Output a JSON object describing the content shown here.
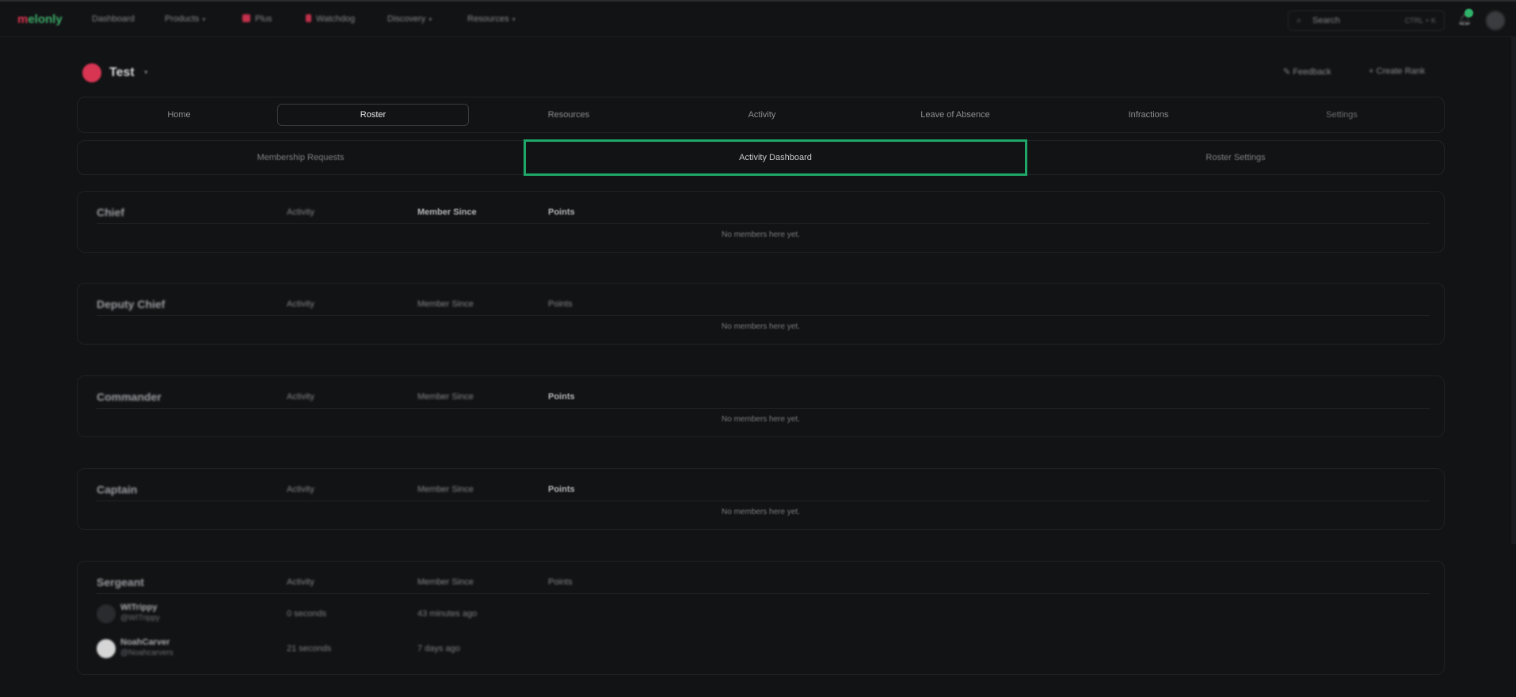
{
  "brand": {
    "prefix": "m",
    "name": "elonly"
  },
  "nav": [
    {
      "label": "Dashboard",
      "caret": ""
    },
    {
      "label": "Products",
      "caret": "▾"
    },
    {
      "label": "Plus",
      "caret": ""
    },
    {
      "label": "Watchdog",
      "caret": ""
    },
    {
      "label": "Discovery",
      "caret": "▾"
    },
    {
      "label": "Resources",
      "caret": "▾"
    }
  ],
  "search": {
    "placeholder": "Search",
    "shortcut": "CTRL + K"
  },
  "org": {
    "name": "Test"
  },
  "actions": {
    "feedback": "Feedback",
    "create_rank": "Create Rank"
  },
  "tabs": [
    "Home",
    "Roster",
    "Resources",
    "Activity",
    "Leave of Absence",
    "Infractions",
    "Settings"
  ],
  "active_tab": "Roster",
  "subtabs": [
    "Membership Requests",
    "Activity Dashboard",
    "Roster Settings"
  ],
  "active_subtab": "Activity Dashboard",
  "columns": {
    "activity": "Activity",
    "member_since": "Member Since",
    "points": "Points"
  },
  "empty_text": "No members here yet.",
  "ranks": [
    {
      "title": "Chief"
    },
    {
      "title": "Deputy Chief"
    },
    {
      "title": "Commander"
    },
    {
      "title": "Captain"
    },
    {
      "title": "Sergeant"
    }
  ],
  "sergeant_members": [
    {
      "name": "WITrippy",
      "handle": "@WITrippy",
      "activity": "0 seconds",
      "member_since": "43 minutes ago"
    },
    {
      "name": "NoahCarver",
      "handle": "@Noahcarvers",
      "activity": "21 seconds",
      "member_since": "7 days ago"
    }
  ],
  "colors": {
    "accent_green": "#1ea868",
    "brand_red": "#e0354f",
    "background": "#121315"
  }
}
